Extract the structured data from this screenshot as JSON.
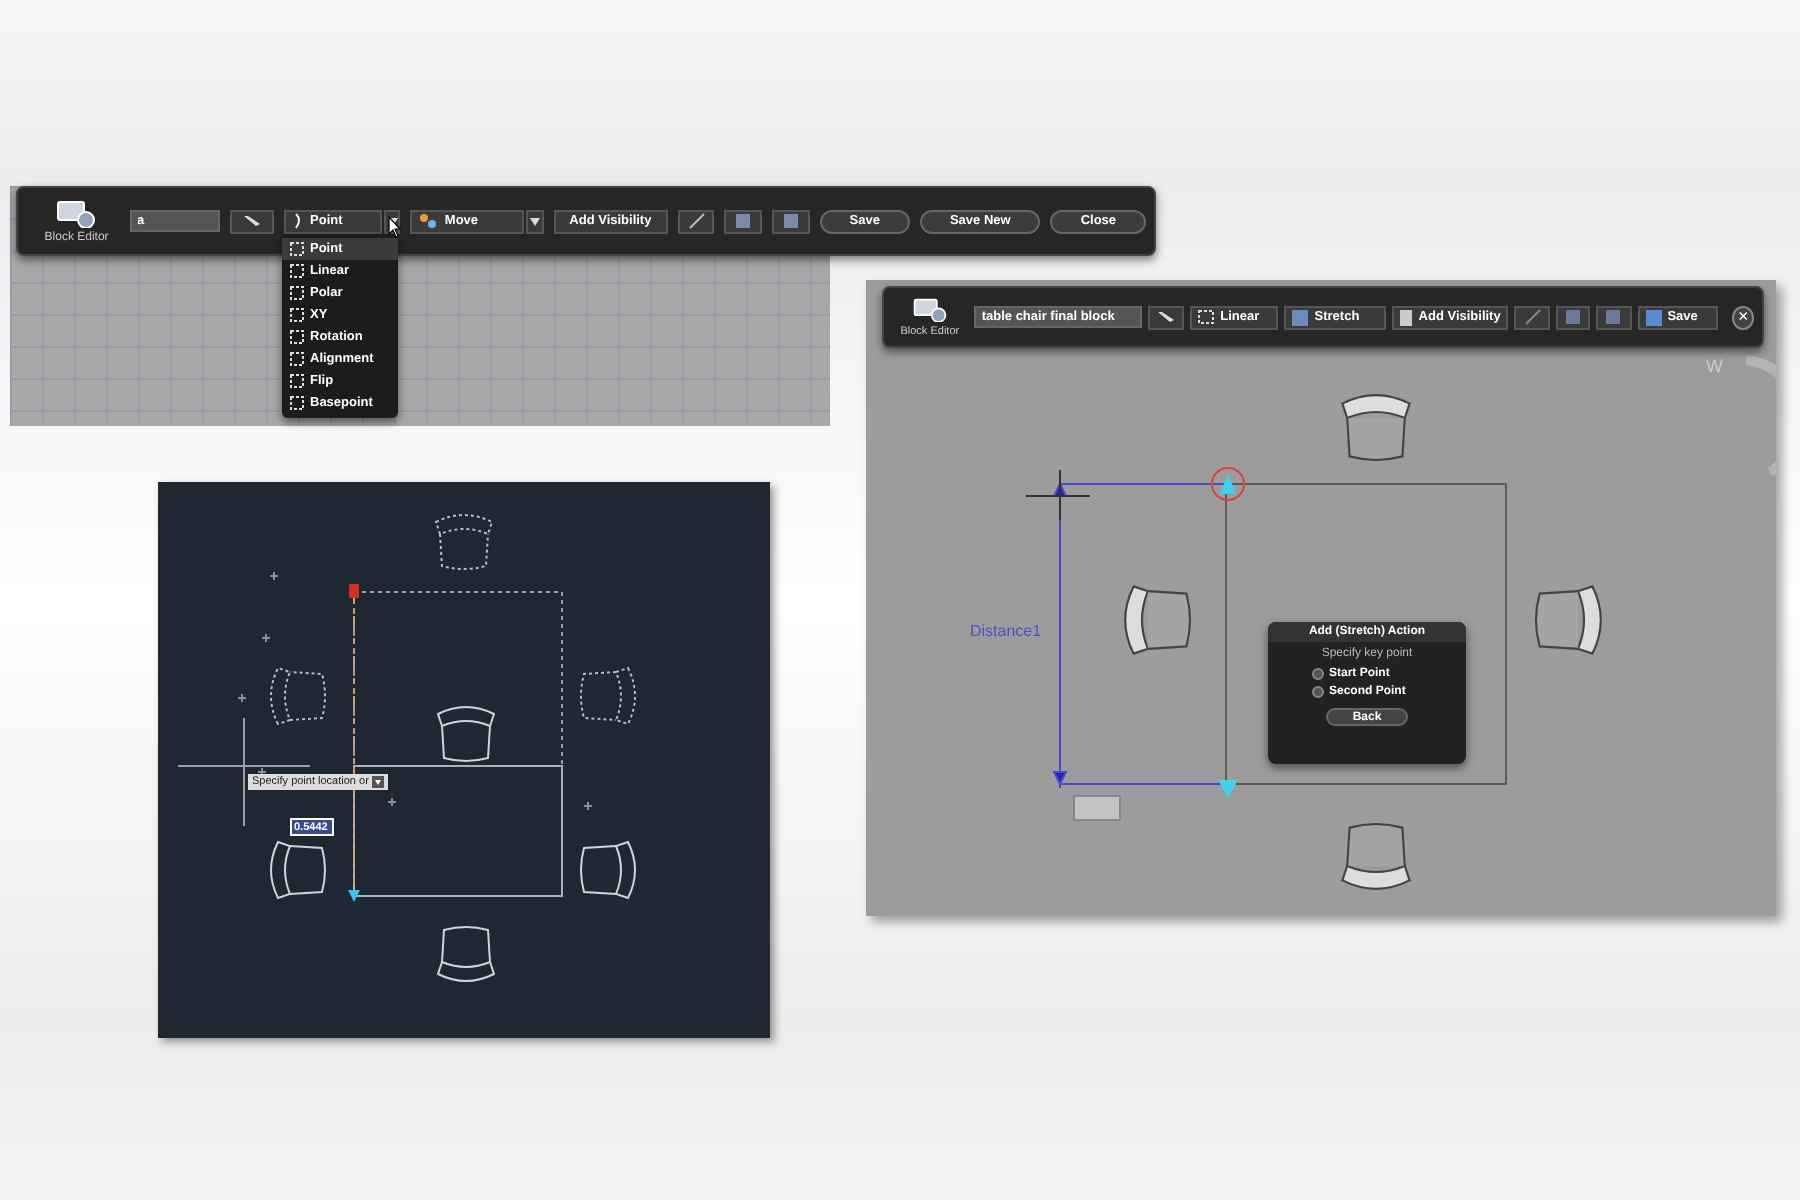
{
  "top_editor": {
    "toolbar": {
      "title": "Block Editor",
      "block_name": "a",
      "parameter": "Point",
      "action": "Move",
      "visibility_button": "Add Visibility",
      "buttons": [
        "Save",
        "Save New",
        "Close"
      ]
    },
    "parameter_menu": [
      {
        "label": "Point",
        "selected": true
      },
      {
        "label": "Linear",
        "selected": false
      },
      {
        "label": "Polar",
        "selected": false
      },
      {
        "label": "XY",
        "selected": false
      },
      {
        "label": "Rotation",
        "selected": false
      },
      {
        "label": "Alignment",
        "selected": false
      },
      {
        "label": "Flip",
        "selected": false
      },
      {
        "label": "Basepoint",
        "selected": false
      }
    ]
  },
  "dark_drawing": {
    "prompt": "Specify point location or",
    "input_value": "0.5442"
  },
  "right_editor": {
    "toolbar": {
      "title": "Block Editor",
      "block_name": "table chair final block",
      "parameter": "Linear",
      "action": "Stretch",
      "visibility_button": "Add Visibility",
      "save": "Save",
      "close": "×"
    },
    "compass_letter": "W",
    "dimension_label": "Distance1",
    "dialog": {
      "title": "Add (Stretch) Action",
      "prompt": "Specify key point",
      "options": [
        {
          "label": "Start Point",
          "selected": false
        },
        {
          "label": "Second Point",
          "selected": false
        }
      ],
      "button": "Back"
    }
  }
}
